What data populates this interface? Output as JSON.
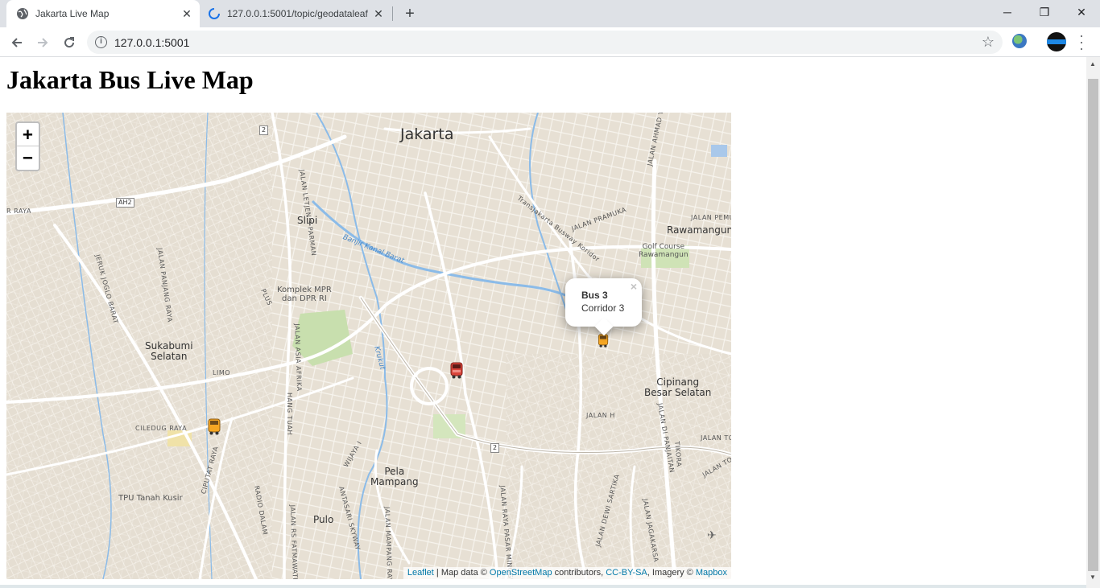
{
  "browser": {
    "tabs": [
      {
        "title": "Jakarta Live Map",
        "active": true
      },
      {
        "title": "127.0.0.1:5001/topic/geodataleaf",
        "active": false
      }
    ],
    "new_tab": "+",
    "url": "127.0.0.1:5001",
    "window_controls": {
      "minimize": "─",
      "restore": "❐",
      "close": "✕"
    }
  },
  "page": {
    "title": "Jakarta Bus Live Map"
  },
  "map": {
    "zoom_in": "+",
    "zoom_out": "−",
    "labels": {
      "jakarta": "Jakarta",
      "slipi": "Slipi",
      "rawamangun": "Rawamangun",
      "golf_1": "Golf Course",
      "golf_2": "Rawamangun",
      "komplek_1": "Komplek MPR",
      "komplek_2": "dan DPR RI",
      "sukabumi_1": "Sukabumi",
      "sukabumi_2": "Selatan",
      "cipinang_1": "Cipinang",
      "cipinang_2": "Besar Selatan",
      "pela_1": "Pela",
      "pela_2": "Mampang",
      "pulo": "Pulo",
      "tpu": "TPU Tanah Kusir",
      "limo": "LIMO",
      "ciledug": "CILEDUG RAYA",
      "raya": "R RAYA",
      "kanal": "Banjir Kanal Barat",
      "krukut": "Krukut",
      "jalan_pramuka": "JALAN PRAMUKA",
      "jalan_pemu": "JALAN PEMU",
      "busway": "Transjakarta Busway Koridor",
      "jalan_panjang": "JALAN PANJANG RAYA",
      "jeruk_joglo": "JERUK JOGLO BARAT",
      "letjen": "JALAN LETJEN S PARMAN",
      "asia_afrika": "JALAN ASIA AFRIKA",
      "hang_tuah": "HANG TUAH",
      "wijaya": "WIJAYA I",
      "ciputat": "CIPUTAT RAYA",
      "radio_dalam": "RADIO DALAM",
      "fatmawati": "JALAN RS FATMAWATI",
      "antasari": "ANTASARI SKYWAY",
      "mampang": "JALAN MAMPANG RAYA",
      "pasar_minggu": "JALAN RAYA PASAR MINGGU",
      "dewi_sartika": "JALAN DEWI SARTIKA",
      "jalan_tol_1": "JALAN TOL",
      "jalan_tol_2": "JALAN TOL",
      "jalan_h": "JALAN H",
      "ahmad_yani": "JALAN AHMAD YANI",
      "di_panjaitan": "JALAN DI PANJAITAN",
      "tikora": "TIKORA",
      "plus": "PLUS",
      "jagakarsa": "JALAN JAGAKARSA"
    },
    "shields": {
      "ah2": "AH2",
      "r2_top": "2",
      "r2_bottom": "2"
    },
    "popup": {
      "bus": "Bus 3",
      "corridor": "Corridor 3",
      "close": "×"
    },
    "markers": [
      {
        "name": "bus-marker-orange-1",
        "color": "#f5a623"
      },
      {
        "name": "bus-marker-red",
        "color": "#d9443a"
      },
      {
        "name": "bus-marker-orange-2",
        "color": "#f5a623"
      }
    ],
    "attribution": {
      "leaflet": "Leaflet",
      "sep1": " | Map data © ",
      "osm": "OpenStreetMap",
      "sep2": " contributors, ",
      "license": "CC-BY-SA",
      "sep3": ", Imagery © ",
      "mapbox": "Mapbox"
    }
  }
}
